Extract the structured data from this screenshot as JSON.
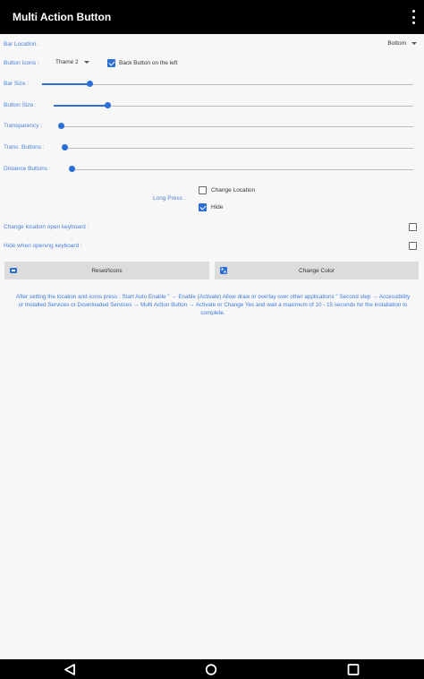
{
  "app": {
    "title": "Multi Action Button"
  },
  "settings": {
    "bar_location": {
      "label": "Bar Location :",
      "value": "Bottom"
    },
    "button_icons": {
      "label": "Button Icons :",
      "value": "Thame 2",
      "back_button_left_label": "Back Button on the left",
      "back_button_left_checked": true
    },
    "sliders": [
      {
        "label": "Bar Size :",
        "value": 0.13
      },
      {
        "label": "Button Size :",
        "value": 0.15
      },
      {
        "label": "Transparency :",
        "value": 0.0
      },
      {
        "label": "Trans. Buttons :",
        "value": 0.0
      },
      {
        "label": "Distance Buttons :",
        "value": 0.0
      }
    ],
    "long_press": {
      "label": "Long Press :",
      "options": [
        {
          "label": "Change Location",
          "checked": false
        },
        {
          "label": "Hide",
          "checked": true
        }
      ]
    },
    "change_location_open_keyboard": {
      "label": "Change location open keyboard :",
      "checked": false
    },
    "hide_when_opening_keyboard": {
      "label": "Hide when opening keyboard :",
      "checked": false
    }
  },
  "buttons": {
    "reset_label": "Reset/Icons",
    "change_color_label": "Change Color"
  },
  "info_text": "After setting the location and icons press : Start Auto Enable \" → Enable (Activate) Allow draw or overlay over other applications \" Second step → Accessibility or Installed Services or Downloaded Services → Multi Action Button → Activate or Change Yes and wait a maximum of 10 - 15 seconds for the installation to complete.",
  "colors": {
    "accent": "#2b6fd6",
    "label_blue": "#4a82d8",
    "appbar": "#000000",
    "background": "#f7f7f7"
  },
  "nav": {
    "icons": [
      "back-icon",
      "home-icon",
      "recents-icon"
    ]
  }
}
